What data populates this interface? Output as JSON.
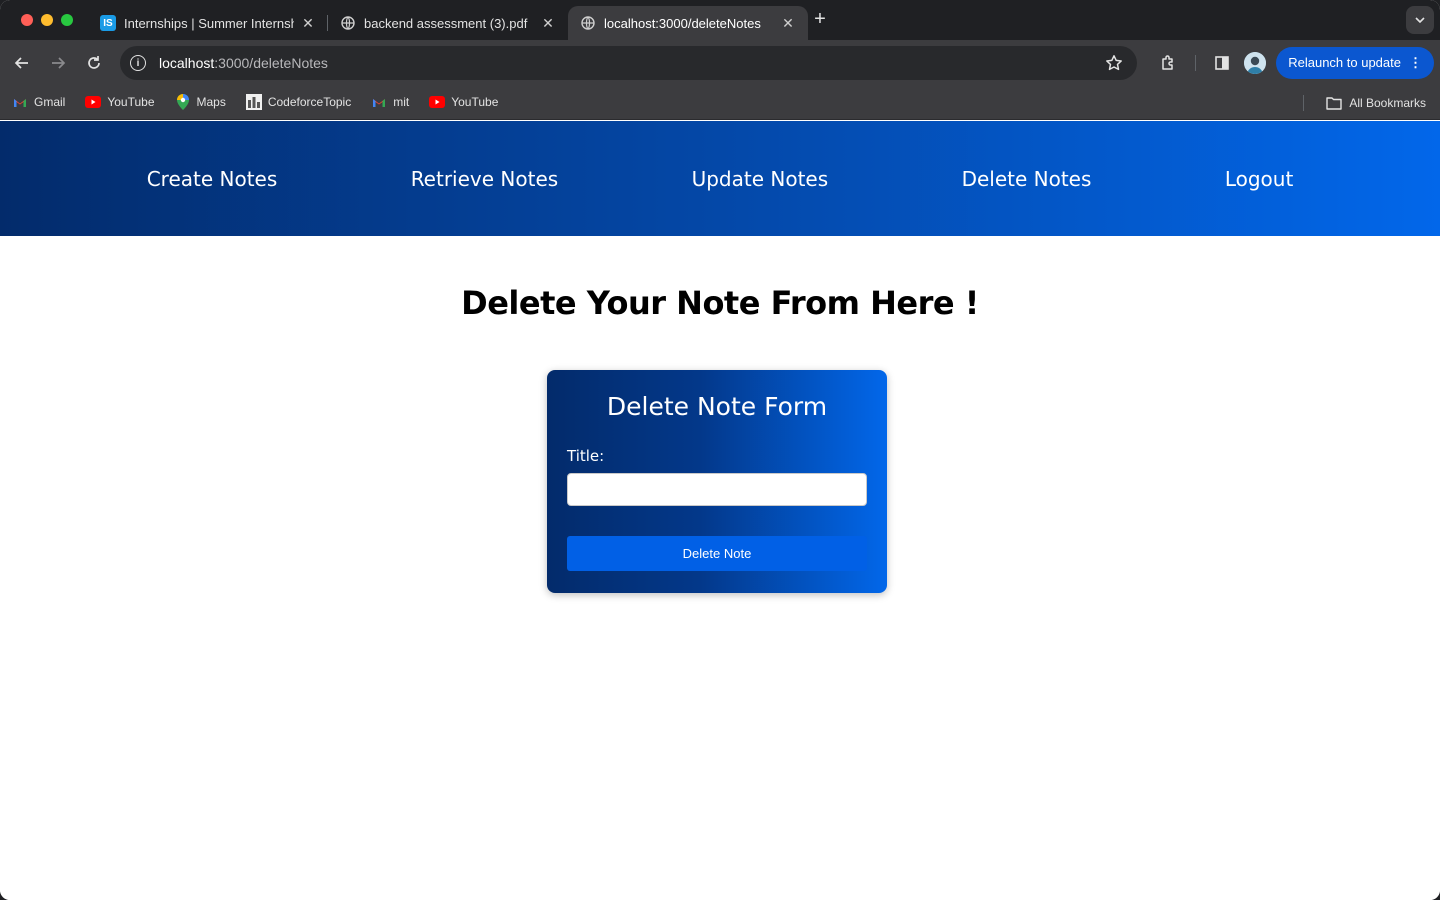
{
  "browser": {
    "tabs": [
      {
        "title": "Internships | Summer Internsh",
        "icon": "internshala-icon"
      },
      {
        "title": "backend assessment (3).pdf",
        "icon": "globe-icon"
      },
      {
        "title": "localhost:3000/deleteNotes",
        "icon": "globe-icon"
      }
    ],
    "url_host": "localhost",
    "url_path": ":3000/deleteNotes",
    "relaunch_label": "Relaunch to update",
    "bookmarks": [
      {
        "label": "Gmail",
        "icon": "gmail-icon"
      },
      {
        "label": "YouTube",
        "icon": "youtube-icon"
      },
      {
        "label": "Maps",
        "icon": "maps-icon"
      },
      {
        "label": "CodeforceTopic",
        "icon": "codeforces-icon"
      },
      {
        "label": "mit",
        "icon": "gmail-icon"
      },
      {
        "label": "YouTube",
        "icon": "youtube-icon"
      }
    ],
    "all_bookmarks_label": "All Bookmarks"
  },
  "nav": {
    "links": [
      "Create Notes",
      "Retrieve Notes",
      "Update Notes",
      "Delete Notes",
      "Logout"
    ]
  },
  "main": {
    "heading": "Delete Your Note From Here !",
    "form": {
      "title": "Delete Note Form",
      "label": "Title:",
      "input_value": "",
      "button_label": "Delete Note"
    }
  },
  "colors": {
    "nav_gradient_start": "#032b6b",
    "nav_gradient_end": "#0267ea",
    "button": "#0160e6"
  }
}
